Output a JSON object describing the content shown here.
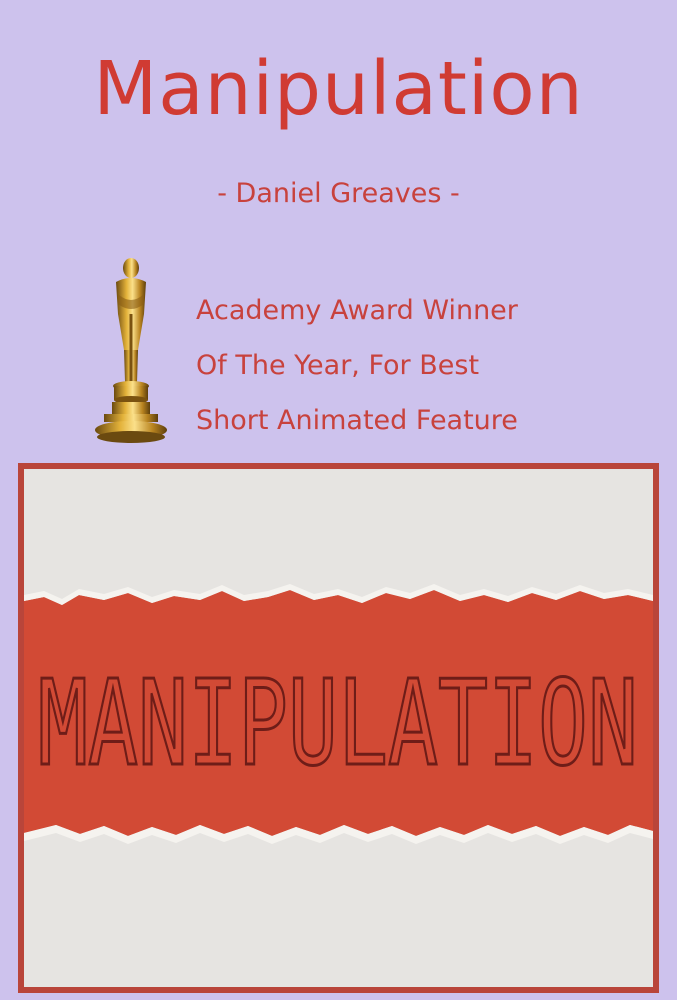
{
  "poster": {
    "title": "Manipulation",
    "subtitle": "- Daniel Greaves -",
    "award_lines": [
      "Academy Award Winner",
      "Of The Year, For Best",
      "Short Animated Feature"
    ],
    "artwork_text": "MANIPULATION",
    "icons": {
      "statuette": "oscar-statuette-icon"
    },
    "colors": {
      "background": "#cdc2ed",
      "text_red": "#c8423d",
      "title_red": "#d03b33",
      "paper": "#e6e4e1",
      "band_red": "#d24a35",
      "frame": "#b9453a"
    }
  }
}
